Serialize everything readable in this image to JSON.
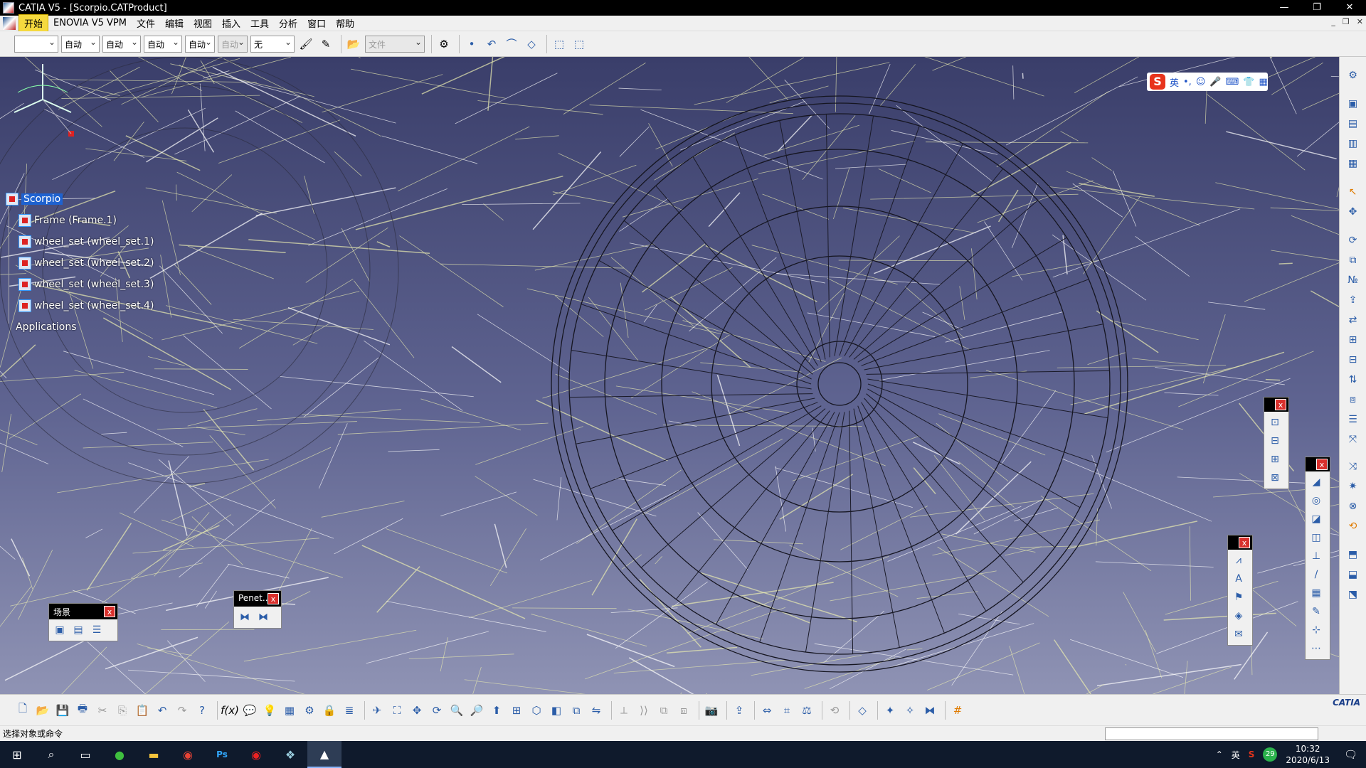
{
  "window": {
    "title": "CATIA V5 - [Scorpio.CATProduct]",
    "controls": [
      "—",
      "❐",
      "✕"
    ]
  },
  "menu": {
    "items": [
      "开始",
      "ENOVIA V5 VPM",
      "文件",
      "编辑",
      "视图",
      "插入",
      "工具",
      "分析",
      "窗口",
      "帮助"
    ],
    "mdi_controls": [
      "_",
      "❐",
      "✕"
    ]
  },
  "toolbar": {
    "combos": [
      "",
      "自动",
      "自动",
      "自动",
      "自动",
      "自动",
      "无"
    ],
    "file_combo": "文件"
  },
  "tree": {
    "root": "Scorpio",
    "children": [
      "Frame (Frame.1)",
      "wheel_set (wheel_set.1)",
      "wheel_set (wheel_set.2)",
      "wheel_set (wheel_set.3)",
      "wheel_set (wheel_set.4)"
    ],
    "applications": "Applications"
  },
  "ime": {
    "logo": "S",
    "lang": "英"
  },
  "floating": {
    "scene_title": "场景",
    "penet_title": "Penet...",
    "close": "x"
  },
  "statusbar": {
    "prompt": "选择对象或命令"
  },
  "bottom": {
    "logo": "CATIA"
  },
  "taskbar": {
    "ime_lang": "英",
    "badge": "29",
    "time": "10:32",
    "date": "2020/6/13"
  }
}
